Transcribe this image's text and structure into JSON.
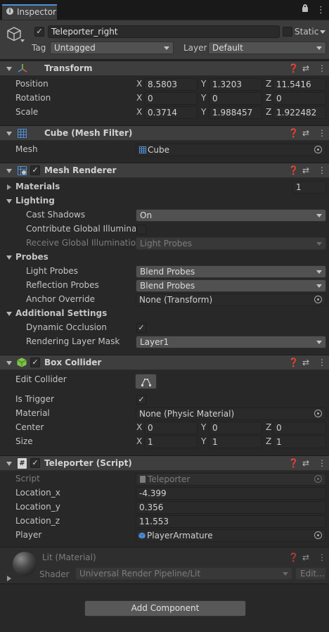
{
  "tab": {
    "title": "Inspector",
    "lock_icon": "lock-icon",
    "menu_icon": "kebab-menu-icon"
  },
  "object": {
    "active": true,
    "name": "Teleporter_right",
    "static_label": "Static",
    "static_checked": false,
    "tag_label": "Tag",
    "tag_value": "Untagged",
    "layer_label": "Layer",
    "layer_value": "Default"
  },
  "transform": {
    "title": "Transform",
    "rows": [
      {
        "label": "Position",
        "x": "8.5803",
        "y": "1.3203",
        "z": "11.5416"
      },
      {
        "label": "Rotation",
        "x": "0",
        "y": "0",
        "z": "0"
      },
      {
        "label": "Scale",
        "x": "0.3714",
        "y": "1.988457",
        "z": "1.922482"
      }
    ]
  },
  "mesh_filter": {
    "title": "Cube (Mesh Filter)",
    "mesh_label": "Mesh",
    "mesh_value": "Cube"
  },
  "mesh_renderer": {
    "title": "Mesh Renderer",
    "enabled": true,
    "materials_label": "Materials",
    "materials_count": "1",
    "lighting_label": "Lighting",
    "cast_shadows_label": "Cast Shadows",
    "cast_shadows_value": "On",
    "contribute_gi_label": "Contribute Global Illuminatio",
    "receive_gi_label": "Receive Global Illumination",
    "receive_gi_value": "Light Probes",
    "probes_label": "Probes",
    "light_probes_label": "Light Probes",
    "light_probes_value": "Blend Probes",
    "reflection_probes_label": "Reflection Probes",
    "reflection_probes_value": "Blend Probes",
    "anchor_override_label": "Anchor Override",
    "anchor_override_value": "None (Transform)",
    "additional_label": "Additional Settings",
    "dynamic_occlusion_label": "Dynamic Occlusion",
    "rendering_layer_label": "Rendering Layer Mask",
    "rendering_layer_value": "Layer1"
  },
  "box_collider": {
    "title": "Box Collider",
    "enabled": true,
    "edit_collider_label": "Edit Collider",
    "is_trigger_label": "Is Trigger",
    "material_label": "Material",
    "material_value": "None (Physic Material)",
    "center_label": "Center",
    "center": {
      "x": "0",
      "y": "0",
      "z": "0"
    },
    "size_label": "Size",
    "size": {
      "x": "1",
      "y": "1",
      "z": "1"
    }
  },
  "script_component": {
    "title": "Teleporter (Script)",
    "enabled": true,
    "script_label": "Script",
    "script_value": "Teleporter",
    "location_x_label": "Location_x",
    "location_x_value": "-4.399",
    "location_y_label": "Location_y",
    "location_y_value": "0.356",
    "location_z_label": "Location_z",
    "location_z_value": "11.553",
    "player_label": "Player",
    "player_value": "PlayerArmature"
  },
  "material": {
    "title": "Lit (Material)",
    "shader_label": "Shader",
    "shader_value": "Universal Render Pipeline/Lit",
    "edit_label": "Edit..."
  },
  "add_component_label": "Add Component",
  "axis_labels": {
    "x": "X",
    "y": "Y",
    "z": "Z"
  },
  "colors": {
    "accent": "#4d90d8",
    "background": "#282828",
    "header": "#3e3e3e"
  }
}
